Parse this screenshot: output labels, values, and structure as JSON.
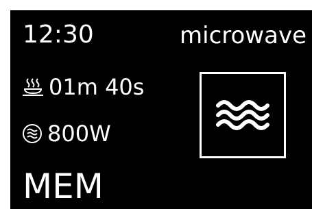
{
  "display": {
    "clock": "12:30",
    "mode_label": "microwave",
    "cook_time": "01m 40s",
    "power": "800W",
    "memory_label": "MEM"
  },
  "icons": {
    "cook_time_icon": "steaming-dish-icon",
    "power_icon": "microwave-waves-circle-icon",
    "mode_icon": "microwave-waves-icon"
  },
  "colors": {
    "background": "#000000",
    "foreground": "#ffffff"
  }
}
